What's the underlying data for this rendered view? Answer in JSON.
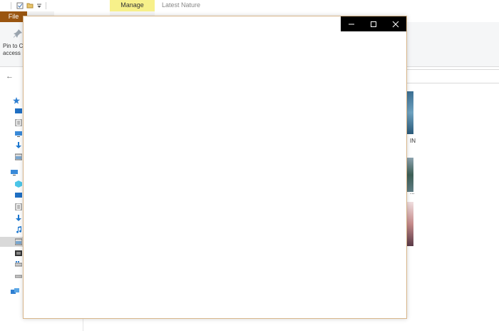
{
  "window": {
    "title": "Latest Nature"
  },
  "ribbon": {
    "file_tab": "File",
    "context_tab": "Manage",
    "pin_label": "Pin to Quick access",
    "pin_label_visible": "Pin to C\naccess"
  },
  "content": {
    "thumbnail_label_1": "IN",
    "thumbnail_label_2": "..."
  },
  "dialog": {
    "controls": [
      "minimize",
      "maximize",
      "close"
    ]
  },
  "colors": {
    "file_tab": "#9a5510",
    "context_tab": "#f7f08a",
    "dialog_border": "#d7b58a",
    "title_bar": "#000000"
  }
}
